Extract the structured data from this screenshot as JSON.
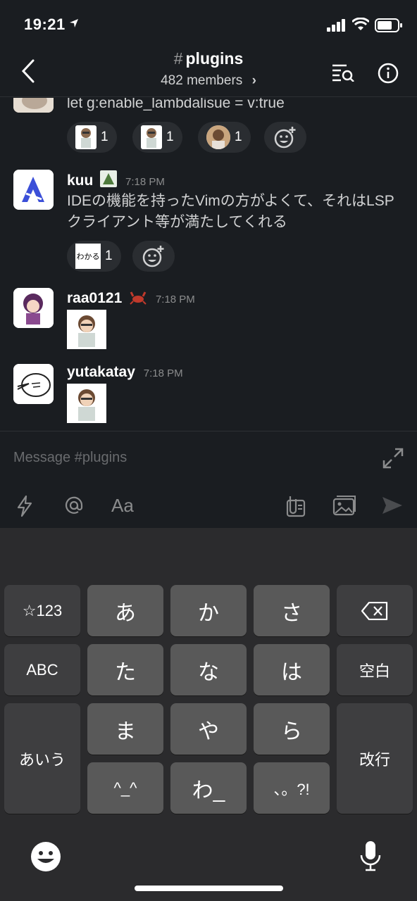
{
  "status_bar": {
    "time": "19:21"
  },
  "header": {
    "hash": "#",
    "channel": "plugins",
    "members": "482 members",
    "members_chevron": "›"
  },
  "messages": [
    {
      "text": "let g:enable_lambdalisue = v:true",
      "reactions": [
        {
          "emoji": "avatar-sticker",
          "count": "1"
        },
        {
          "emoji": "avatar-sticker",
          "count": "1"
        },
        {
          "emoji": "avatar-sticker-alt",
          "count": "1"
        }
      ]
    },
    {
      "name": "kuu",
      "time": "7:18 PM",
      "text": "IDEの機能を持ったVimの方がよくて、それはLSPクライアント等が満たしてくれる",
      "reactions": [
        {
          "emoji": "わかる",
          "count": "1"
        }
      ]
    },
    {
      "name": "raa0121",
      "time": "7:18 PM"
    },
    {
      "name": "yutakatay",
      "time": "7:18 PM"
    }
  ],
  "composer": {
    "placeholder": "Message #plugins",
    "format_label": "Aa"
  },
  "keyboard": {
    "keys": {
      "k123": "☆123",
      "a": "あ",
      "ka": "か",
      "sa": "さ",
      "abc": "ABC",
      "ta": "た",
      "na": "な",
      "ha": "は",
      "space": "空白",
      "aiu": "あいう",
      "ma": "ま",
      "ya": "や",
      "ra": "ら",
      "enter": "改行",
      "kao": "^_^",
      "wa": "わ_",
      "punct": "、。?!"
    }
  },
  "colors": {
    "background": "#1a1d21",
    "keyboard": "#2b2b2d",
    "key": "#595959",
    "key_dark": "#3e3e40"
  }
}
